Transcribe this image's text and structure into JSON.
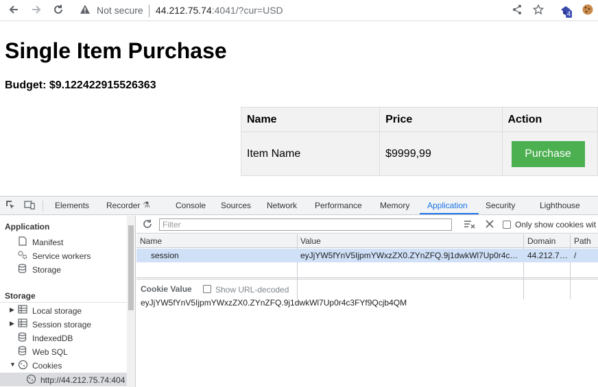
{
  "browser": {
    "security_label": "Not secure",
    "url_host": "44.212.75.74",
    "url_rest": ":4041/?cur=USD",
    "extension_badge": "4"
  },
  "page": {
    "title": "Single Item Purchase",
    "budget": "Budget: $9.122422915526363",
    "table": {
      "headers": [
        "Name",
        "Price",
        "Action"
      ],
      "rows": [
        {
          "name": "Item Name",
          "price": "$9999,99",
          "action": "Purchase"
        }
      ]
    },
    "colors": {
      "purchase_button": "#4caf50"
    }
  },
  "devtools": {
    "tabs": [
      "Elements",
      "Recorder",
      "Console",
      "Sources",
      "Network",
      "Performance",
      "Memory",
      "Application",
      "Security",
      "Lighthouse"
    ],
    "active_tab": "Application",
    "sidebar": {
      "application_header": "Application",
      "application_items": [
        "Manifest",
        "Service workers",
        "Storage"
      ],
      "storage_header": "Storage",
      "storage_items": [
        "Local storage",
        "Session storage",
        "IndexedDB",
        "Web SQL",
        "Cookies"
      ],
      "cookie_origin": "http://44.212.75.74:404"
    },
    "cookies": {
      "filter_placeholder": "Filter",
      "only_issues_label": "Only show cookies wit",
      "columns": [
        "Name",
        "Value",
        "Domain",
        "Path"
      ],
      "rows": [
        {
          "name": "session",
          "value": "eyJjYW5fYnV5IjpmYWxzZX0.ZYnZFQ.9j1dwkWl7Up0r4c…",
          "domain": "44.212.7…",
          "path": "/"
        }
      ],
      "cookie_value_label": "Cookie Value",
      "show_url_decoded_label": "Show URL-decoded",
      "cookie_value": "eyJjYW5fYnV5IjpmYWxzZX0.ZYnZFQ.9j1dwkWl7Up0r4c3FYf9Qcjb4QM"
    }
  }
}
